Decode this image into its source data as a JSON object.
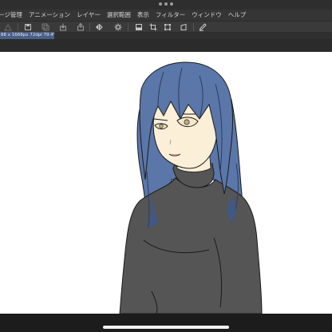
{
  "app": {
    "window_handle_icon": "more-dots-icon"
  },
  "menu": [
    "ージ管理",
    "アニメーション",
    "レイヤー",
    "選択範囲",
    "表示",
    "フィルター",
    "ウィンドウ",
    "ヘルプ"
  ],
  "toolbar": {
    "icons": [
      "triangle-ruler-icon",
      "save-icon",
      "copy-icon",
      "import-icon",
      "export-icon",
      "flip-horizontal-icon",
      "gear-icon",
      "color-fill-icon",
      "crop-icon",
      "transform-icon",
      "pen-icon"
    ]
  },
  "document": {
    "tab_label": "88 x 1668px 72dpi 79.4%)"
  },
  "canvas": {
    "background": "#ffffff",
    "subject": "illustration-character"
  },
  "colors": {
    "hair": "#5b76a8",
    "hair_shadow": "#3f5887",
    "skin": "#fbefd8",
    "sweater": "#555555",
    "outline": "#1a1a1a",
    "tab_active": "#4a5f86"
  }
}
